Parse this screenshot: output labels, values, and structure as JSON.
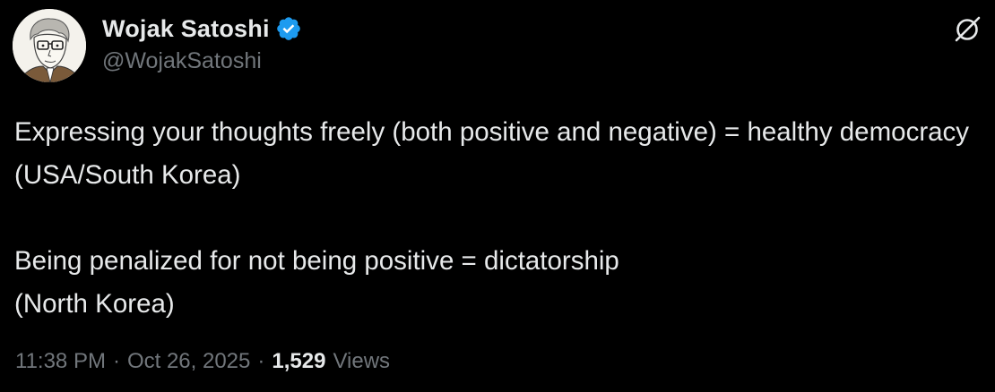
{
  "author": {
    "display_name": "Wojak Satoshi",
    "handle": "@WojakSatoshi",
    "avatar_icon": "wojak-avatar",
    "verified_icon": "verified-badge-icon",
    "verified_color": "#1d9bf0"
  },
  "actions": {
    "grok_icon": "grok-icon"
  },
  "tweet": {
    "text": "Expressing your thoughts freely (both positive and negative) = healthy democracy (USA/South Korea)\n\nBeing penalized for not being positive = dictatorship\n(North Korea)"
  },
  "meta": {
    "time": "11:38 PM",
    "separator": "·",
    "date": "Oct 26, 2025",
    "views_count": "1,529",
    "views_label": "Views"
  },
  "colors": {
    "background": "#000000",
    "primary_text": "#e7e9ea",
    "secondary_text": "#71767b",
    "accent": "#1d9bf0"
  }
}
